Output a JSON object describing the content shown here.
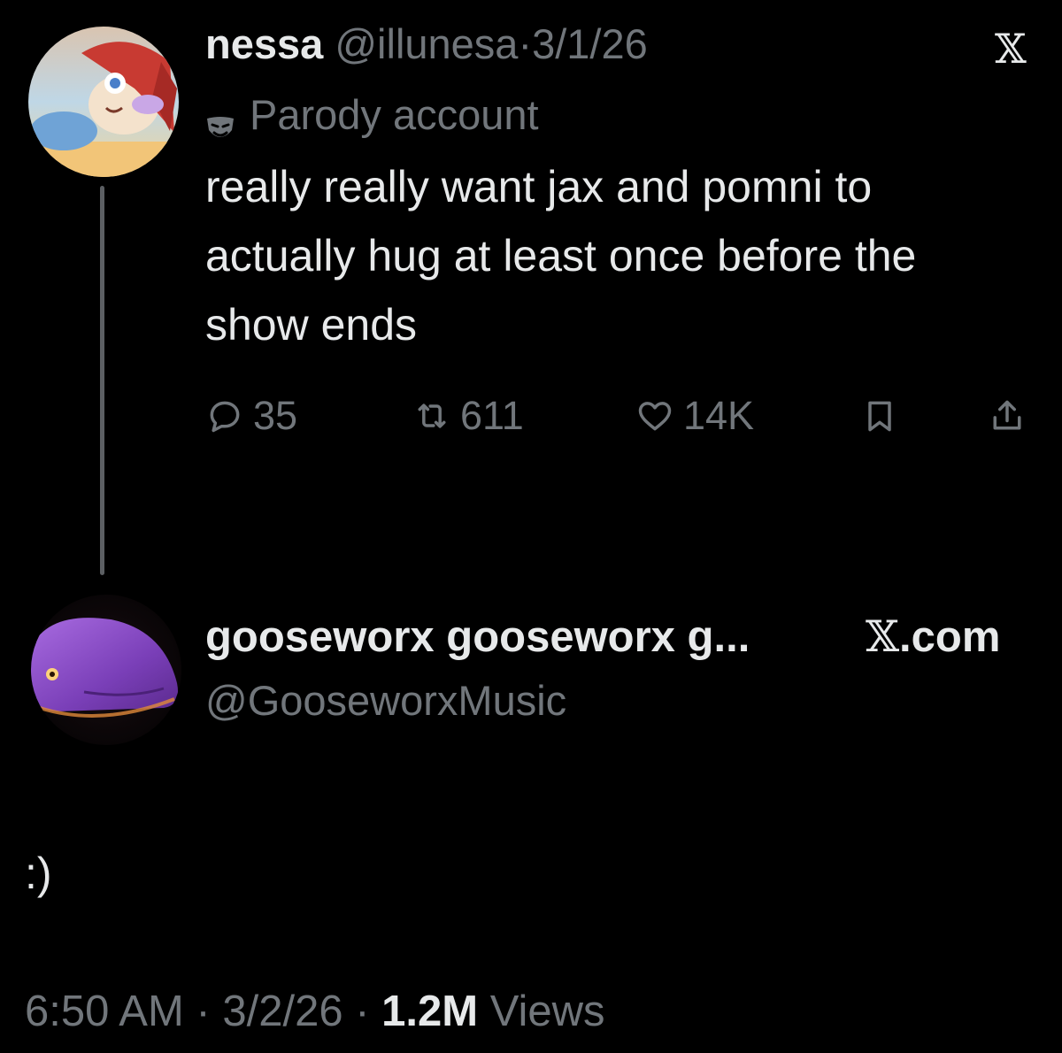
{
  "quoted_tweet": {
    "display_name": "nessa",
    "handle": "@illunesa",
    "separator": "·",
    "date": "3/1/26",
    "badge_label": "Parody account",
    "text": "really really want jax and pomni to actually hug at least once before the show ends",
    "stats": {
      "replies": "35",
      "retweets": "611",
      "likes": "14K"
    },
    "icons": [
      "reply-icon",
      "retweet-icon",
      "like-icon",
      "bookmark-icon",
      "share-icon",
      "parody-mask-icon",
      "x-logo-icon"
    ]
  },
  "x_logo": "𝕏",
  "reply_tweet": {
    "display_name": "gooseworx gooseworx g...",
    "source_glyph": "𝕏",
    "source_label": ".com",
    "handle": "@GooseworxMusic",
    "text": ":)",
    "time": "6:50 AM",
    "separator": "·",
    "date": "3/2/26",
    "views_count": "1.2M",
    "views_label": "Views"
  },
  "colors": {
    "background": "#000000",
    "primary_text": "#e7e9ea",
    "muted_text": "#71767b",
    "thread_line": "#5c5f63"
  }
}
